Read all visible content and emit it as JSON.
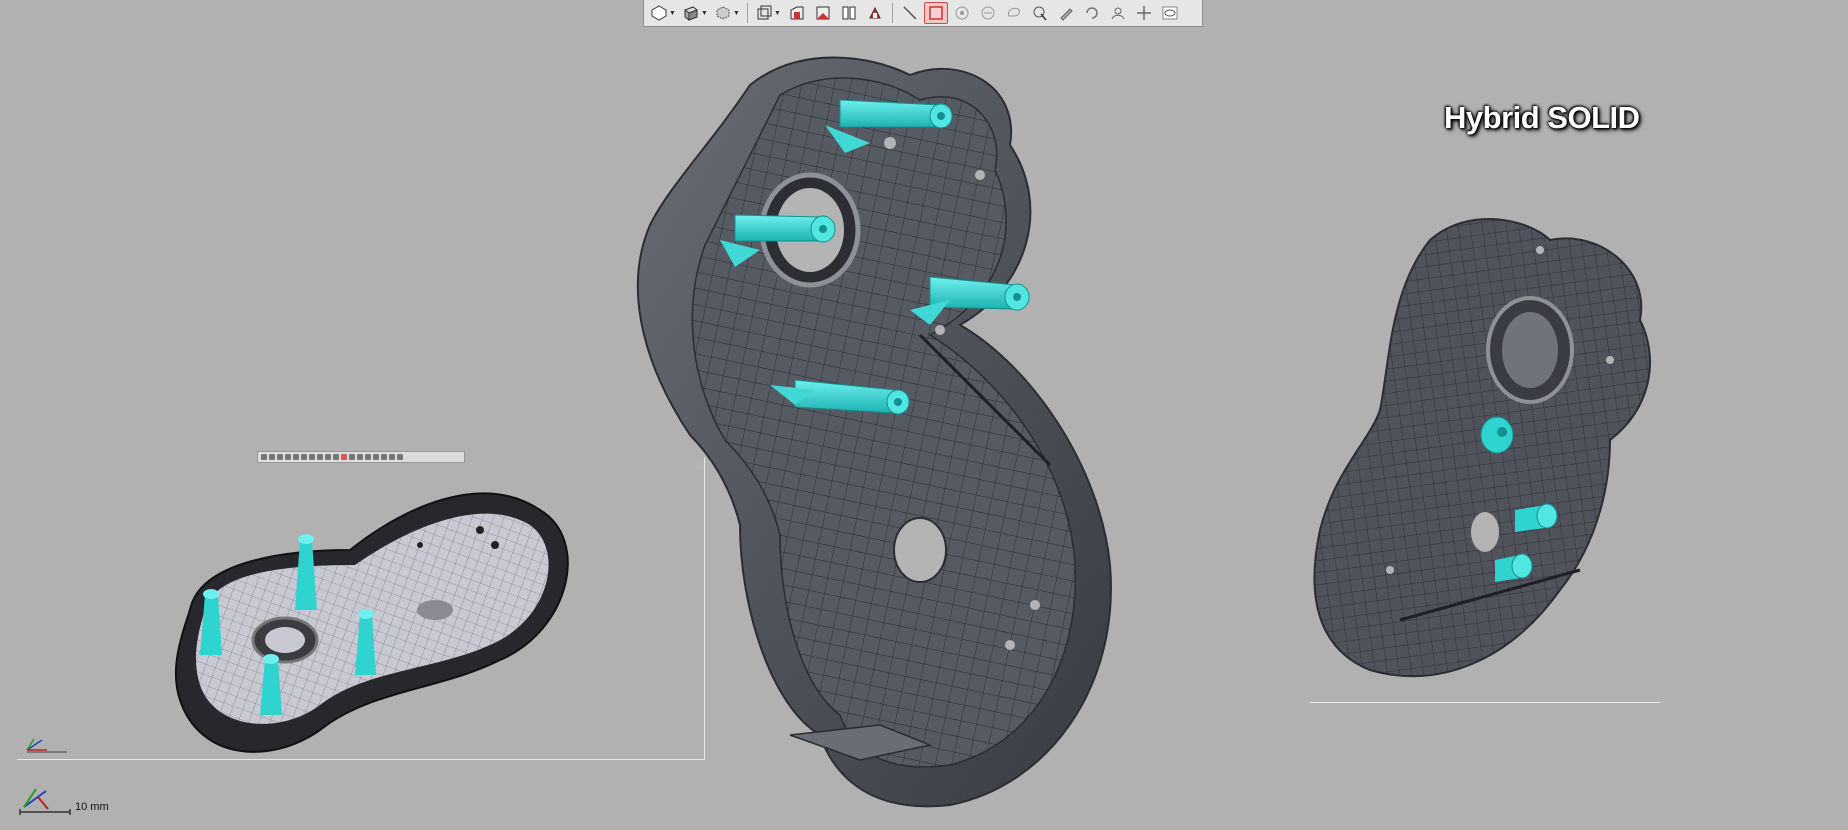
{
  "toolbar": {
    "buttons": [
      {
        "icon": "view-orientation-icon",
        "dropdown": true
      },
      {
        "icon": "display-style-icon",
        "dropdown": true
      },
      {
        "icon": "hide-show-icon",
        "dropdown": true
      },
      {
        "icon": "section-view-icon",
        "dropdown": true
      },
      {
        "icon": "view-front-icon"
      },
      {
        "icon": "view-side-icon"
      },
      {
        "icon": "split-view-icon"
      },
      {
        "icon": "zoom-to-fit-icon"
      },
      {
        "icon": "measure-icon"
      },
      {
        "icon": "box-select-icon",
        "active": true
      },
      {
        "icon": "pick-point-icon"
      },
      {
        "icon": "pick-edge-icon"
      },
      {
        "icon": "lasso-icon"
      },
      {
        "icon": "select-tool-icon"
      },
      {
        "icon": "edit-icon"
      },
      {
        "icon": "rotate-icon"
      },
      {
        "icon": "pan-icon"
      },
      {
        "icon": "zoom-icon"
      },
      {
        "icon": "visibility-icon"
      }
    ]
  },
  "label": {
    "text": "Hybrid SOLID"
  },
  "scale": {
    "text": "10 mm"
  },
  "colors": {
    "background": "#b1b1b1",
    "model": "#4a4d55",
    "feature": "#2fd3d0",
    "accent": "#d04a4a"
  }
}
